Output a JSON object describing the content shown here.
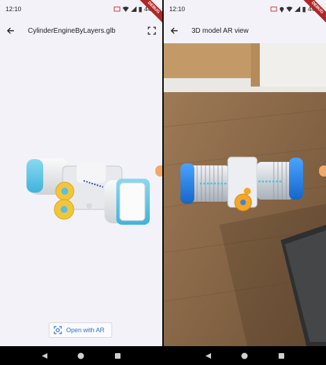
{
  "left_screen": {
    "status": {
      "time": "12:10",
      "battery": "44%"
    },
    "debug_label": "DEBUG",
    "appbar": {
      "title": "CylinderEngineByLayers.glb"
    },
    "ar_button": {
      "label": "Open with AR"
    }
  },
  "right_screen": {
    "status": {
      "time": "12:10",
      "battery": "44%"
    },
    "debug_label": "DEBUG",
    "appbar": {
      "title": "3D model AR view"
    }
  },
  "icons": {
    "back": "arrow-left-icon",
    "fullscreen": "fullscreen-icon",
    "ar": "ar-view-icon",
    "nav_back": "nav-back-icon",
    "nav_home": "nav-home-icon",
    "nav_recents": "nav-recents-icon"
  },
  "colors": {
    "accent": "#2d6fd2",
    "model_blue": "#1e88e5",
    "model_cyan": "#5ec9e8",
    "gear_yellow": "#f2c63b",
    "debug_red": "#b02626"
  }
}
